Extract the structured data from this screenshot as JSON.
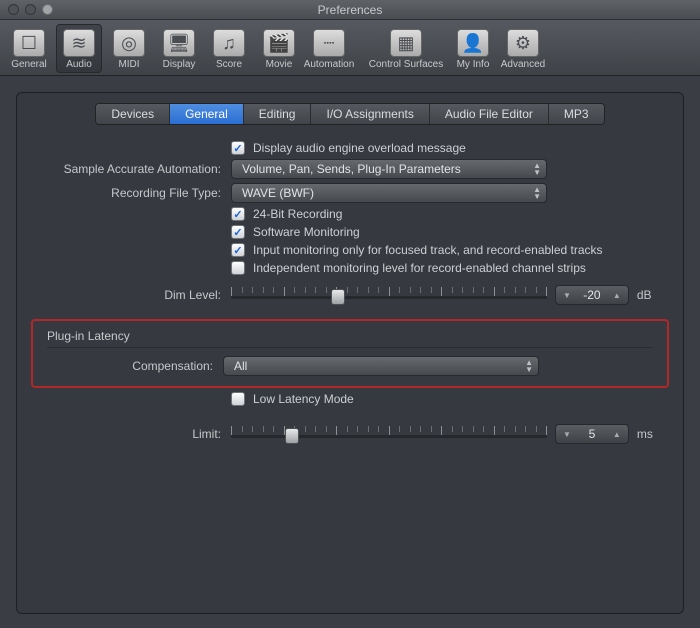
{
  "window": {
    "title": "Preferences"
  },
  "toolbar": {
    "items": [
      {
        "label": "General",
        "glyph": "☐"
      },
      {
        "label": "Audio",
        "glyph": "≋"
      },
      {
        "label": "MIDI",
        "glyph": "◎"
      },
      {
        "label": "Display",
        "glyph": "🖥"
      },
      {
        "label": "Score",
        "glyph": "♫"
      },
      {
        "label": "Movie",
        "glyph": "🎬"
      },
      {
        "label": "Automation",
        "glyph": "┈"
      },
      {
        "label": "Control Surfaces",
        "glyph": "▦"
      },
      {
        "label": "My Info",
        "glyph": "👤"
      },
      {
        "label": "Advanced",
        "glyph": "⚙"
      }
    ],
    "active_index": 1
  },
  "tabs": {
    "items": [
      "Devices",
      "General",
      "Editing",
      "I/O Assignments",
      "Audio File Editor",
      "MP3"
    ],
    "active_index": 1
  },
  "general": {
    "overload_label": "Display audio engine overload message",
    "overload_checked": true,
    "sample_accurate_label": "Sample Accurate Automation:",
    "sample_accurate_value": "Volume, Pan, Sends, Plug-In Parameters",
    "recording_file_label": "Recording File Type:",
    "recording_file_value": "WAVE (BWF)",
    "chk_24bit": {
      "label": "24-Bit Recording",
      "checked": true
    },
    "chk_swmon": {
      "label": "Software Monitoring",
      "checked": true
    },
    "chk_inputmon": {
      "label": "Input monitoring only for focused track, and record-enabled tracks",
      "checked": true
    },
    "chk_indep": {
      "label": "Independent monitoring level for record-enabled channel strips",
      "checked": false
    },
    "dim_label": "Dim Level:",
    "dim_value": "-20",
    "dim_unit": "dB",
    "dim_knob_percent": 33
  },
  "latency": {
    "section_title": "Plug-in Latency",
    "compensation_label": "Compensation:",
    "compensation_value": "All",
    "low_latency": {
      "label": "Low Latency Mode",
      "checked": false
    },
    "limit_label": "Limit:",
    "limit_value": "5",
    "limit_unit": "ms",
    "limit_knob_percent": 18
  }
}
